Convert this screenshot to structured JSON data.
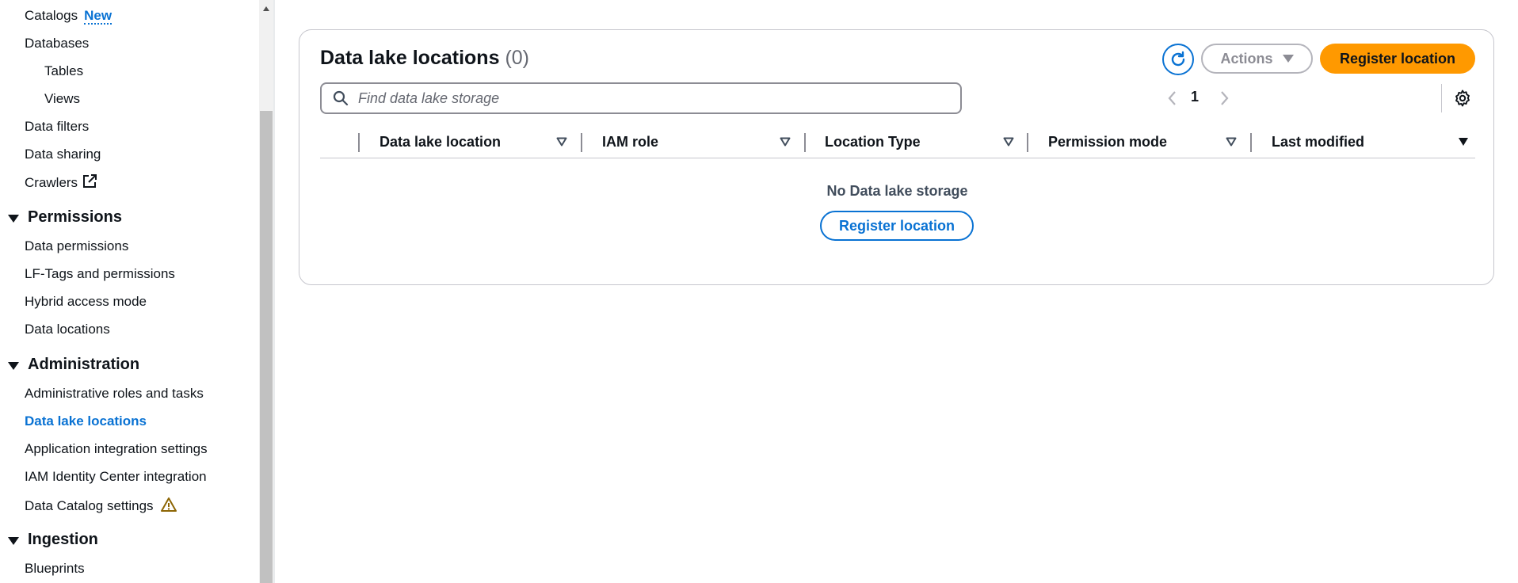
{
  "sidebar": {
    "catalogs": {
      "label": "Catalogs",
      "badge": "New"
    },
    "catalog_items": [
      {
        "label": "Databases"
      },
      {
        "label": "Tables"
      },
      {
        "label": "Views"
      },
      {
        "label": "Data filters"
      },
      {
        "label": "Data sharing"
      },
      {
        "label": "Crawlers"
      }
    ],
    "sections": [
      {
        "title": "Permissions",
        "items": [
          {
            "label": "Data permissions"
          },
          {
            "label": "LF-Tags and permissions"
          },
          {
            "label": "Hybrid access mode"
          },
          {
            "label": "Data locations"
          }
        ]
      },
      {
        "title": "Administration",
        "items": [
          {
            "label": "Administrative roles and tasks"
          },
          {
            "label": "Data lake locations"
          },
          {
            "label": "Application integration settings"
          },
          {
            "label": "IAM Identity Center integration"
          },
          {
            "label": "Data Catalog settings"
          }
        ]
      },
      {
        "title": "Ingestion",
        "items": [
          {
            "label": "Blueprints"
          }
        ]
      }
    ],
    "active_item": "Data lake locations"
  },
  "main": {
    "title": "Data lake locations",
    "count": "(0)",
    "actions_label": "Actions",
    "register_label": "Register location",
    "search_placeholder": "Find data lake storage",
    "search_value": "",
    "page": "1",
    "columns": [
      {
        "label": "Data lake location"
      },
      {
        "label": "IAM role"
      },
      {
        "label": "Location Type"
      },
      {
        "label": "Permission mode"
      },
      {
        "label": "Last modified"
      }
    ],
    "empty_text": "No Data lake storage",
    "empty_button": "Register location"
  },
  "colors": {
    "accent": "#0972d3",
    "primary_button": "#ff9900",
    "warning": "#8d6605",
    "border": "#c6c6cd"
  },
  "icons": [
    "external-link-icon",
    "warning-icon",
    "refresh-icon",
    "caret-down-icon",
    "search-icon",
    "chevron-left-icon",
    "chevron-right-icon",
    "settings-gear-icon",
    "sort-icon",
    "sort-descending-icon"
  ]
}
